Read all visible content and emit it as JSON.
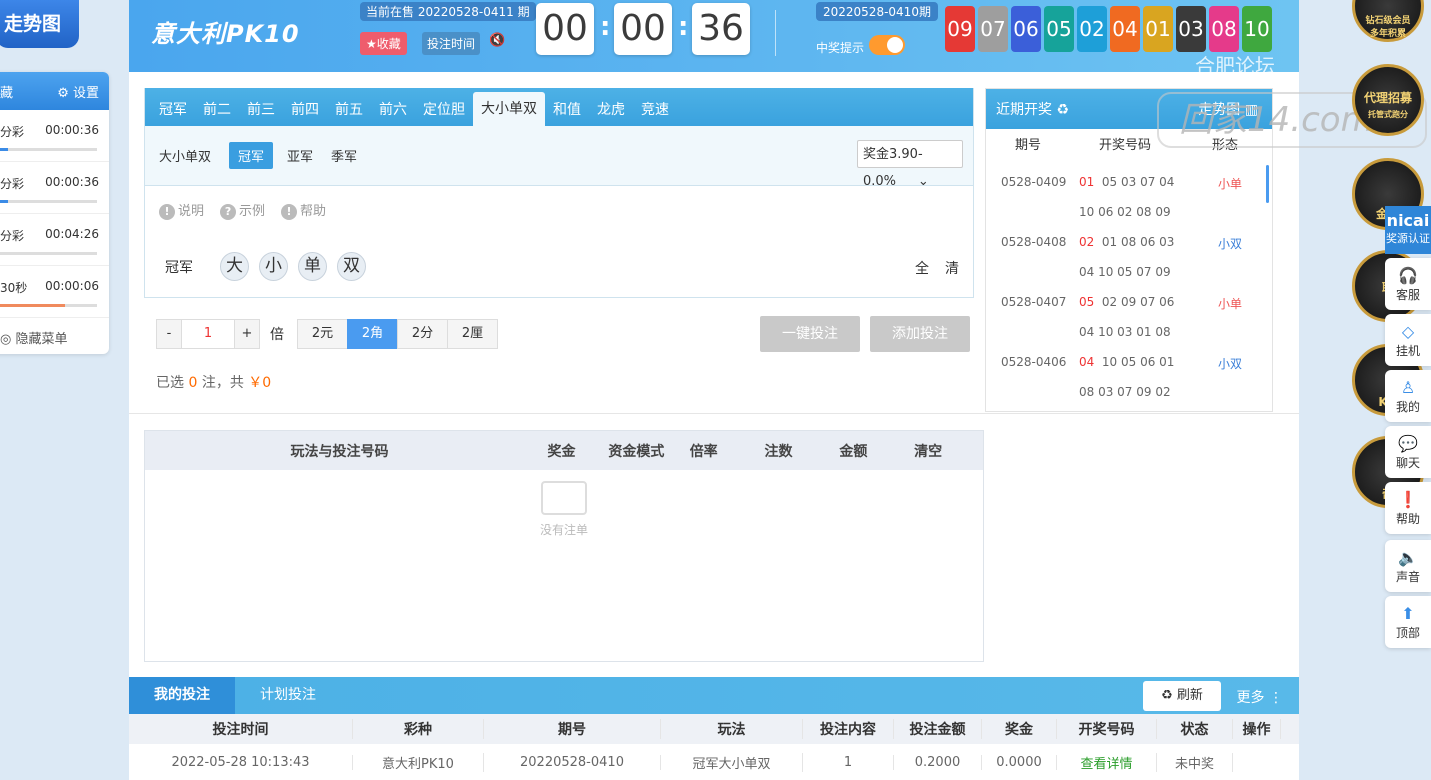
{
  "left": {
    "trend_label": "走势图",
    "fav_label": "藏",
    "settings_label": "设置",
    "rows": [
      {
        "name": "分彩",
        "time": "00:00:36",
        "progress": 0.17
      },
      {
        "name": "分彩",
        "time": "00:00:36",
        "progress": 0.17
      },
      {
        "name": "分彩",
        "time": "00:04:26",
        "progress": 0.02
      },
      {
        "name": "30秒",
        "time": "00:00:06",
        "progress": 0.7
      }
    ],
    "hide_menu": "隐藏菜单"
  },
  "header": {
    "logo": "意大利PK10",
    "current_issue": "当前在售 20220528-0411 期",
    "fav_btn": "★收藏",
    "bet_time_btn": "投注时间",
    "mute_icon": "speaker-mute-icon",
    "countdown": [
      "00",
      "00",
      "36"
    ],
    "last_issue": "20220528-0410期",
    "win_notify": "中奖提示",
    "result_balls": [
      {
        "n": "09",
        "color": "#e53935"
      },
      {
        "n": "07",
        "color": "#9e9e9e"
      },
      {
        "n": "06",
        "color": "#3b5fd9"
      },
      {
        "n": "05",
        "color": "#16a39a"
      },
      {
        "n": "02",
        "color": "#1e9fd8"
      },
      {
        "n": "04",
        "color": "#f06a21"
      },
      {
        "n": "01",
        "color": "#d9a520"
      },
      {
        "n": "03",
        "color": "#3a3a3a"
      },
      {
        "n": "08",
        "color": "#e53a8a"
      },
      {
        "n": "10",
        "color": "#3fa83f"
      }
    ]
  },
  "play": {
    "tabs": [
      "冠军",
      "前二",
      "前三",
      "前四",
      "前五",
      "前六",
      "定位胆",
      "大小单双",
      "和值",
      "龙虎",
      "竞速"
    ],
    "active_tab": 7,
    "sub_label": "大小单双",
    "sub_options": [
      "冠军",
      "亚军",
      "季军"
    ],
    "prize": "奖金3.90-0.0%",
    "help": [
      "说明",
      "示例",
      "帮助"
    ],
    "row_label": "冠军",
    "numbers": [
      "大",
      "小",
      "单",
      "双"
    ],
    "quick": [
      "全",
      "清"
    ]
  },
  "bet": {
    "minus": "-",
    "multiple": "1",
    "plus": "+",
    "multiple_unit": "倍",
    "units": [
      "2元",
      "2角",
      "2分",
      "2厘"
    ],
    "active_unit": 1,
    "one_click": "一键投注",
    "add_bet": "添加投注",
    "selected_prefix": "已选",
    "selected_count": "0",
    "selected_mid": "注，共",
    "selected_amount": "￥0"
  },
  "history": {
    "title": "近期开奖 ♻",
    "trend_link": "走势图",
    "cols": [
      "期号",
      "开奖号码",
      "形态"
    ],
    "rows": [
      {
        "issue": "0528-0409",
        "first": "01",
        "line1": "05 03 07 04",
        "line2": "10 06 02 08 09",
        "form": "小单"
      },
      {
        "issue": "0528-0408",
        "first": "02",
        "line1": "01 08 06 03",
        "line2": "04 10 05 07 09",
        "form": "小双"
      },
      {
        "issue": "0528-0407",
        "first": "05",
        "line1": "02 09 07 06",
        "line2": "04 10 03 01 08",
        "form": "小单"
      },
      {
        "issue": "0528-0406",
        "first": "04",
        "line1": "10 05 06 01",
        "line2": "08 03 07 09 02",
        "form": "小双"
      }
    ]
  },
  "cart": {
    "cols": [
      "玩法与投注号码",
      "奖金",
      "资金模式",
      "倍率",
      "注数",
      "金额",
      "清空"
    ],
    "empty": "没有注单"
  },
  "my_bets": {
    "tabs": [
      "我的投注",
      "计划投注"
    ],
    "refresh": "♻ 刷新",
    "more": "更多 ⋮",
    "cols": [
      "投注时间",
      "彩种",
      "期号",
      "玩法",
      "投注内容",
      "投注金额",
      "奖金",
      "开奖号码",
      "状态",
      "操作"
    ],
    "rows": [
      [
        "2022-05-28 10:13:43",
        "意大利PK10",
        "20220528-0410",
        "冠军大小单双",
        "1",
        "0.2000",
        "0.0000",
        "查看详情",
        "未中奖",
        ""
      ]
    ]
  },
  "right": {
    "watermark": "回家14.com",
    "watermark_top": "合肥论坛",
    "badge1_top": "钻石级会员",
    "badge1_sub": "多年积累",
    "badge2": "代理招募",
    "badge2_sub": "托管式跑分",
    "badge3": "金典",
    "badge4": "聊",
    "badge5": "KG",
    "badge6": "奇",
    "nicai": "nicai",
    "nicai_sub": "奖源认证",
    "side": [
      {
        "icon": "headset-icon",
        "label": "客服"
      },
      {
        "icon": "diamond-icon",
        "label": "挂机"
      },
      {
        "icon": "user-icon",
        "label": "我的"
      },
      {
        "icon": "chat-icon",
        "label": "聊天"
      },
      {
        "icon": "help-icon",
        "label": "帮助"
      },
      {
        "icon": "speaker-icon",
        "label": "声音"
      },
      {
        "icon": "arrow-up-icon",
        "label": "顶部"
      }
    ]
  }
}
